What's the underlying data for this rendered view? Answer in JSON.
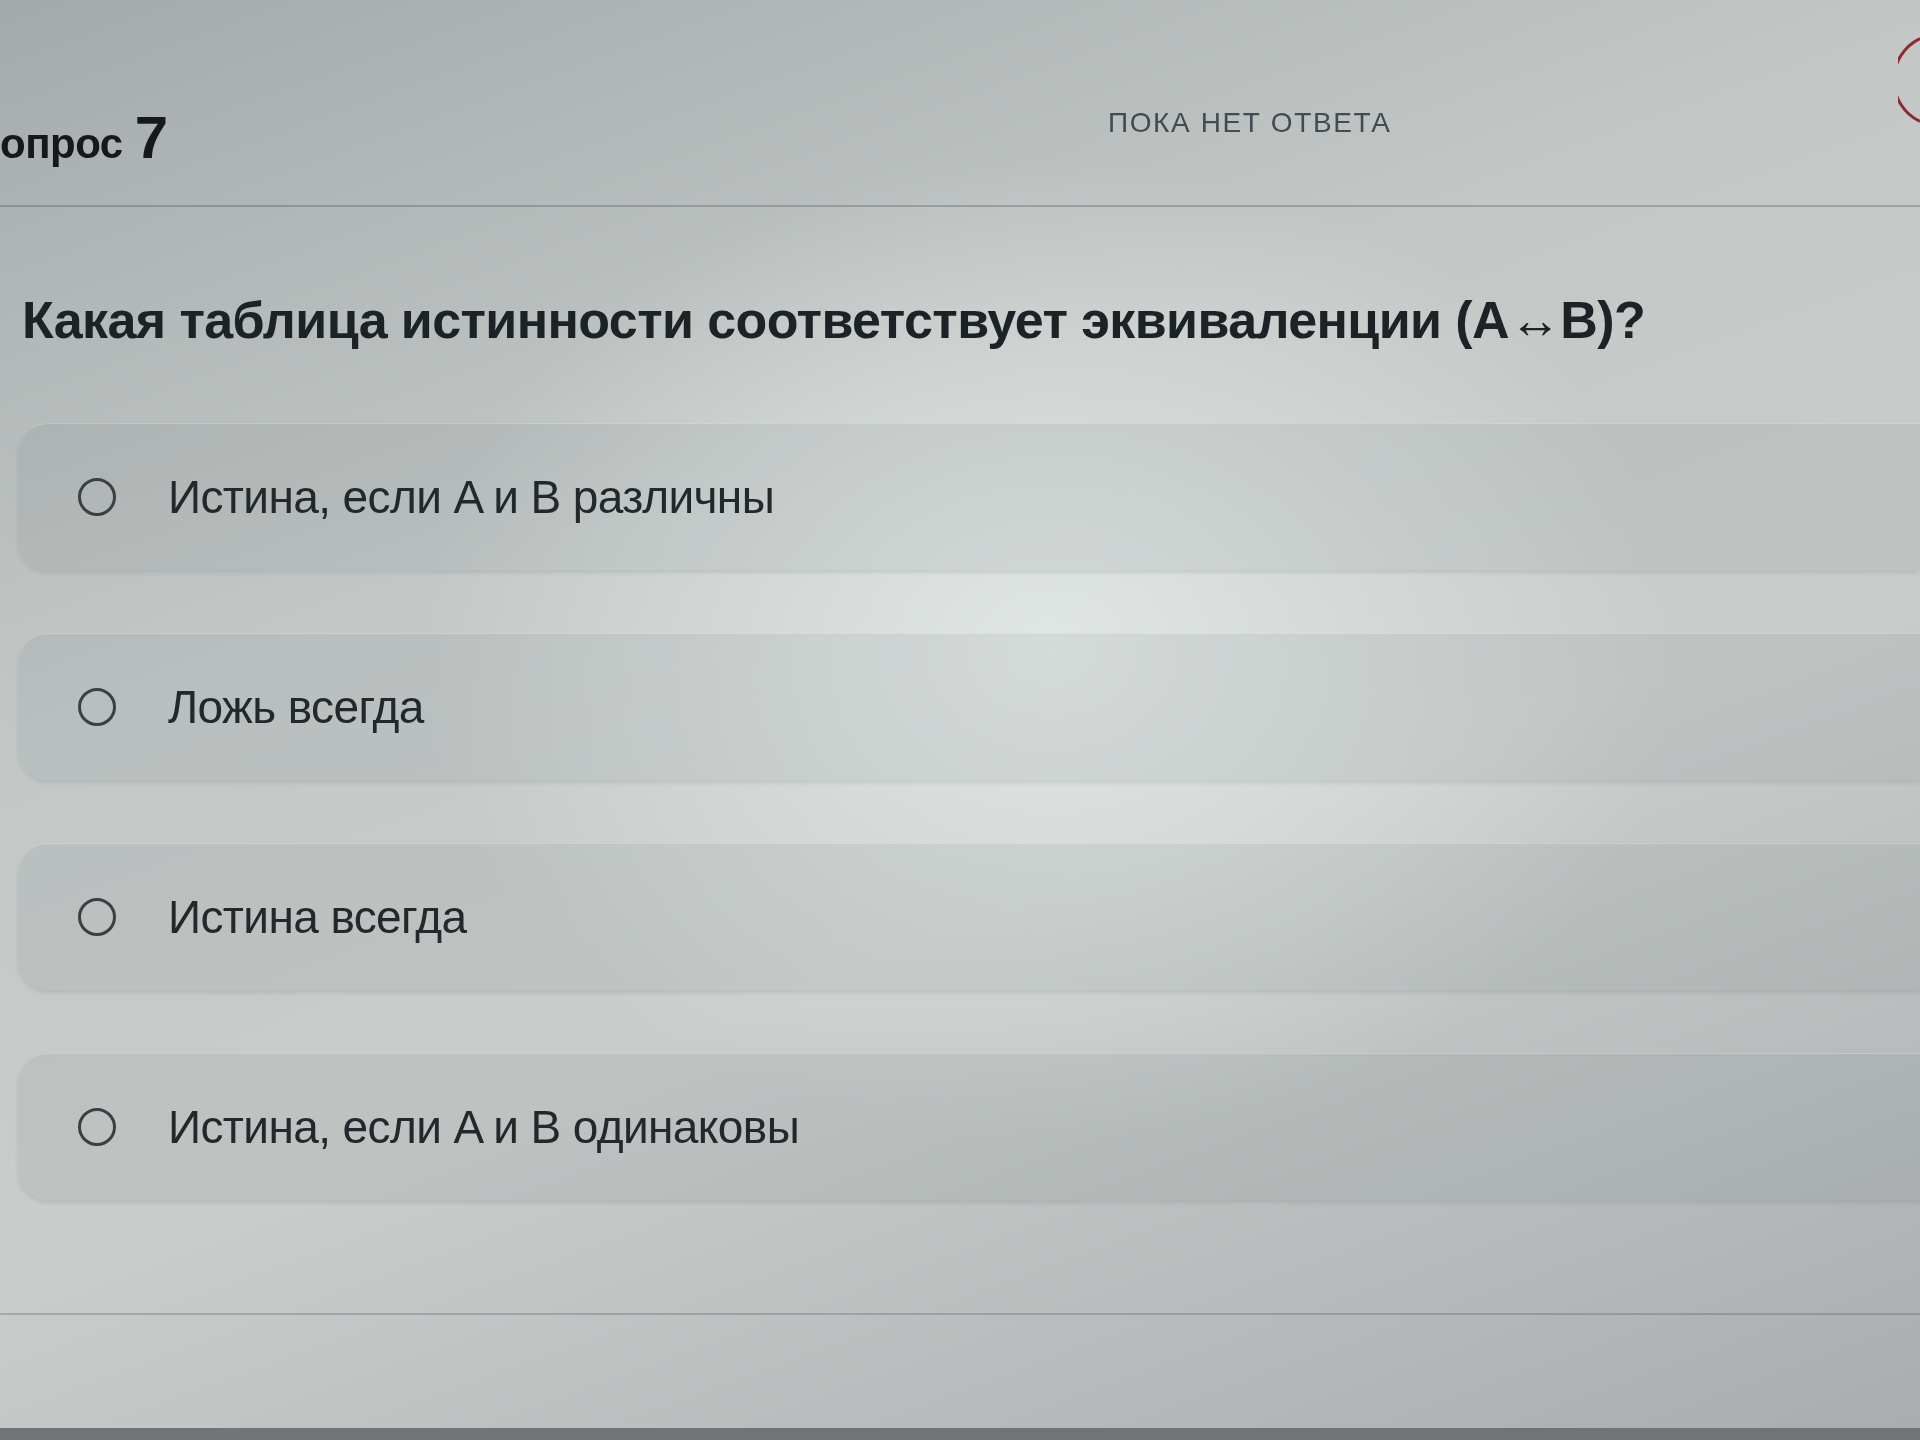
{
  "header": {
    "label": "опрос",
    "number": "7",
    "status": "ПОКА НЕТ ОТВЕТА"
  },
  "question": {
    "text": "Какая таблица истинности соответствует эквиваленции (A↔B)?"
  },
  "options": [
    {
      "label": "Истина, если A и B различны",
      "selected": false
    },
    {
      "label": "Ложь всегда",
      "selected": false
    },
    {
      "label": "Истина всегда",
      "selected": false
    },
    {
      "label": "Истина, если A и B одинаковы",
      "selected": false
    }
  ]
}
